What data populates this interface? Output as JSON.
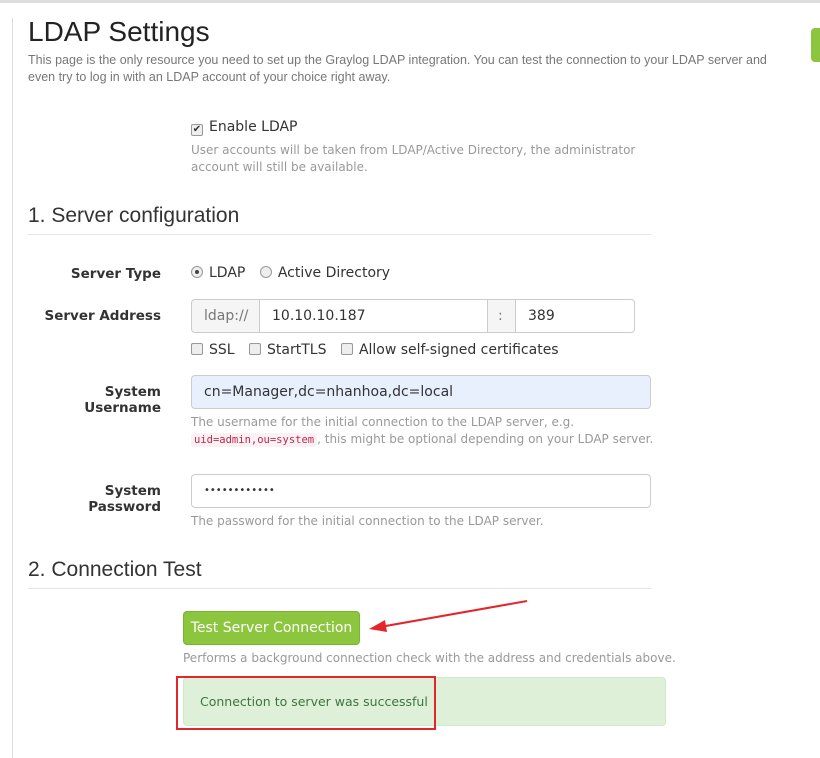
{
  "title": "LDAP Settings",
  "intro": "This page is the only resource you need to set up the Graylog LDAP integration. You can test the connection to your LDAP server and even try to log in with an LDAP account of your choice right away.",
  "enable": {
    "label": "Enable LDAP",
    "checked": true,
    "help": "User accounts will be taken from LDAP/Active Directory, the administrator account will still be available."
  },
  "section1": "1. Server configuration",
  "server_type": {
    "label": "Server Type",
    "options": [
      "LDAP",
      "Active Directory"
    ],
    "selected": "LDAP"
  },
  "server_address": {
    "label": "Server Address",
    "prefix": "ldap://",
    "host": "10.10.10.187",
    "sep": ":",
    "port": "389"
  },
  "options": {
    "ssl": "SSL",
    "starttls": "StartTLS",
    "selfsigned": "Allow self-signed certificates"
  },
  "system_username": {
    "label": "System Username",
    "value": "cn=Manager,dc=nhanhoa,dc=local",
    "help1": "The username for the initial connection to the LDAP server, e.g.",
    "help_code": "uid=admin,ou=system",
    "help2": ", this might be optional depending on your LDAP server."
  },
  "system_password": {
    "label": "System Password",
    "value": "••••••••••••",
    "help": "The password for the initial connection to the LDAP server."
  },
  "section2": "2. Connection Test",
  "test_button": "Test Server Connection",
  "test_help": "Performs a background connection check with the address and credentials above.",
  "result": "Connection to server was successful",
  "colors": {
    "accent": "#8cc63f",
    "success_bg": "#dff0d8",
    "annotation": "#e3262b"
  }
}
